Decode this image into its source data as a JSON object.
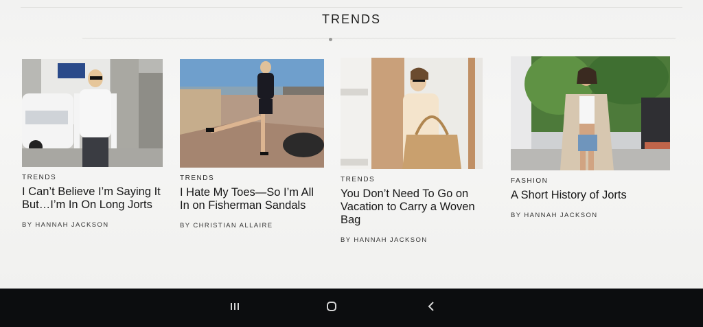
{
  "section": {
    "title": "TRENDS"
  },
  "articles": [
    {
      "category": "TRENDS",
      "headline": "I Can’t Believe I’m Saying It But…I’m In On Long Jorts",
      "byline": "BY HANNAH JACKSON"
    },
    {
      "category": "TRENDS",
      "headline": "I Hate My Toes—So I’m All In on Fisherman Sandals",
      "byline": "BY CHRISTIAN ALLAIRE"
    },
    {
      "category": "TRENDS",
      "headline": "You Don’t Need To Go on Vacation to Carry a Woven Bag",
      "byline": "BY HANNAH JACKSON"
    },
    {
      "category": "FASHION",
      "headline": "A Short History of Jorts",
      "byline": "BY HANNAH JACKSON"
    }
  ],
  "nav": {
    "recents_icon": "recents-icon",
    "home_icon": "home-icon",
    "back_icon": "back-icon"
  }
}
